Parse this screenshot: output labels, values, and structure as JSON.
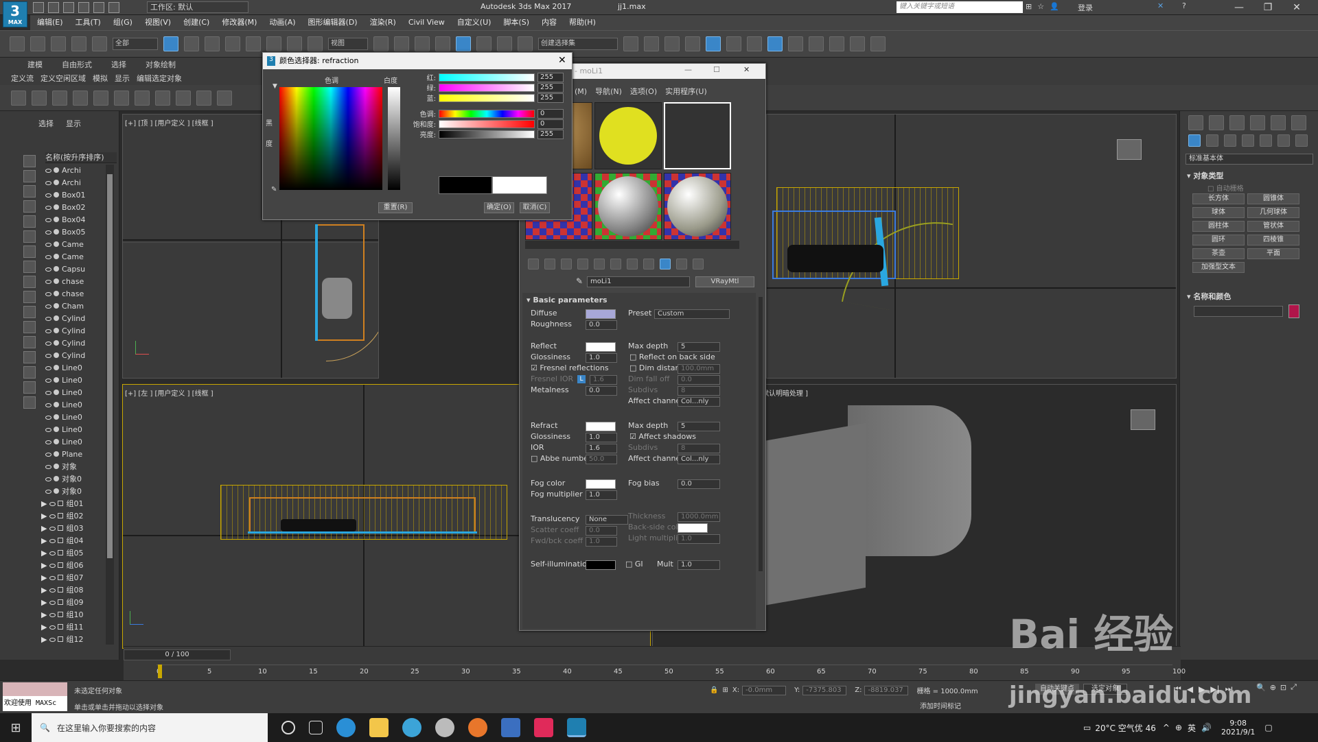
{
  "window": {
    "app_logo": "3",
    "app_logo_sub": "MAX",
    "workspace": "工作区: 默认",
    "title": "Autodesk 3ds Max 2017",
    "file": "jj1.max",
    "search_placeholder": "键入关键字或短语",
    "login": "登录"
  },
  "menu": [
    "编辑(E)",
    "工具(T)",
    "组(G)",
    "视图(V)",
    "创建(C)",
    "修改器(M)",
    "动画(A)",
    "图形编辑器(D)",
    "渲染(R)",
    "Civil View",
    "自定义(U)",
    "脚本(S)",
    "内容",
    "帮助(H)"
  ],
  "toolbar": {
    "filter_dropdown": "全部",
    "view_dropdown": "视图",
    "selection_set_dropdown": "创建选择集"
  },
  "ribbon": {
    "tabs": [
      "建模",
      "自由形式",
      "选择",
      "对象绘制"
    ],
    "sub_items": [
      "定义流",
      "定义空闲区域",
      "模拟",
      "显示",
      "编辑选定对象"
    ]
  },
  "scene_explorer": {
    "tabs": [
      "选择",
      "显示"
    ],
    "header": "名称(按升序排序)",
    "items": [
      "Archi",
      "Archi",
      "Box01",
      "Box02",
      "Box04",
      "Box05",
      "Came",
      "Came",
      "Capsu",
      "chase",
      "chase",
      "Cham",
      "Cylind",
      "Cylind",
      "Cylind",
      "Cylind",
      "Line0",
      "Line0",
      "Line0",
      "Line0",
      "Line0",
      "Line0",
      "Line0",
      "Plane",
      "对象",
      "对象0",
      "对象0"
    ],
    "groups": [
      "组01",
      "组02",
      "组03",
      "组04",
      "组05",
      "组06",
      "组07",
      "组08",
      "组09",
      "组10",
      "组11",
      "组12"
    ]
  },
  "viewports": {
    "top_label": "[+] [顶 ] [用户定义 ] [线框 ]",
    "left_label": "[+] [左 ] [用户定义 ] [线框 ]",
    "persp_label": "默认明暗处理 ]"
  },
  "color_picker": {
    "title": "颜色选择器: refraction",
    "hue_label": "色调",
    "whiteness_label": "白度",
    "black_label": "黑",
    "degree_label": "度",
    "rows": [
      {
        "label": "红:",
        "value": "255"
      },
      {
        "label": "绿:",
        "value": "255"
      },
      {
        "label": "蓝:",
        "value": "255"
      },
      {
        "label": "色调:",
        "value": "0"
      },
      {
        "label": "饱和度:",
        "value": "0"
      },
      {
        "label": "亮度:",
        "value": "255"
      }
    ],
    "reset_button": "重置(R)",
    "ok_button": "确定(O)",
    "cancel_button": "取消(C)"
  },
  "material_editor": {
    "title": "- moLi1",
    "menu": [
      "(M)",
      "导航(N)",
      "选项(O)",
      "实用程序(U)"
    ],
    "material_name": "moLi1",
    "material_type": "VRayMtl",
    "rollout": "Basic parameters",
    "diffuse": {
      "label": "Diffuse",
      "color": "#a8a8d8"
    },
    "preset_label": "Preset",
    "preset_value": "Custom",
    "roughness": {
      "label": "Roughness",
      "value": "0.0"
    },
    "reflect": {
      "label": "Reflect",
      "color": "#ffffff"
    },
    "max_depth_label": "Max depth",
    "max_depth_reflect": "5",
    "glossiness_reflect": {
      "label": "Glossiness",
      "value": "1.0"
    },
    "reflect_back": "Reflect on back side",
    "fresnel": "Fresnel reflections",
    "dim_distance": {
      "label": "Dim distance",
      "value": "100.0mm"
    },
    "fresnel_ior": {
      "label": "Fresnel IOR",
      "value": "1.6",
      "lock": "L"
    },
    "dim_falloff": {
      "label": "Dim fall off",
      "value": "0.0"
    },
    "subdivs_label": "Subdivs",
    "subdivs_value": "8",
    "metalness": {
      "label": "Metalness",
      "value": "0.0"
    },
    "affect_channels_label": "Affect channels",
    "affect_channels_value": "Col...nly",
    "refract": {
      "label": "Refract",
      "color": "#ffffff"
    },
    "max_depth_refract": "5",
    "glossiness_refract": {
      "label": "Glossiness",
      "value": "1.0"
    },
    "affect_shadows": "Affect shadows",
    "ior": {
      "label": "IOR",
      "value": "1.6"
    },
    "abbe": {
      "label": "Abbe number",
      "value": "50.0"
    },
    "fog_color": {
      "label": "Fog color",
      "color": "#ffffff"
    },
    "fog_bias": {
      "label": "Fog bias",
      "value": "0.0"
    },
    "fog_multiplier": {
      "label": "Fog multiplier",
      "value": "1.0"
    },
    "translucency": {
      "label": "Translucency",
      "value": "None"
    },
    "thickness": {
      "label": "Thickness",
      "value": "1000.0mm"
    },
    "scatter": {
      "label": "Scatter coeff",
      "value": "0.0"
    },
    "backside": {
      "label": "Back-side color",
      "color": "#ffffff"
    },
    "fwdbck": {
      "label": "Fwd/bck coeff",
      "value": "1.0"
    },
    "light_mult": {
      "label": "Light multiplier",
      "value": "1.0"
    },
    "self_illum": {
      "label": "Self-illumination",
      "color": "#000000"
    },
    "gi": "GI",
    "mult": {
      "label": "Mult",
      "value": "1.0"
    }
  },
  "command_panel": {
    "dropdown": "标准基本体",
    "section1": "对象类型",
    "auto_grid": "自动栅格",
    "buttons": [
      "长方体",
      "圆锥体",
      "球体",
      "几何球体",
      "圆柱体",
      "管状体",
      "圆环",
      "四棱锥",
      "茶壶",
      "平面",
      "加强型文本"
    ],
    "section2": "名称和颜色",
    "color": "#b0154a"
  },
  "timeline": {
    "slider": "0 / 100",
    "ticks": [
      "0",
      "5",
      "10",
      "15",
      "20",
      "25",
      "30",
      "35",
      "40",
      "45",
      "50",
      "55",
      "60",
      "65",
      "70",
      "75",
      "80",
      "85",
      "90",
      "95",
      "100"
    ]
  },
  "status": {
    "maxscript": "欢迎使用 MAXSc",
    "line1": "未选定任何对象",
    "line2": "单击或单击并拖动以选择对象",
    "x_label": "X:",
    "x_value": "-0.0mm",
    "y_label": "Y:",
    "y_value": "-7375.803",
    "z_label": "Z:",
    "z_value": "-8819.037",
    "grid": "栅格 = 1000.0mm",
    "auto_key": "自动关键点",
    "selected": "选定对象",
    "add_time_tag": "添加时间标记"
  },
  "taskbar": {
    "search": "在这里输入你要搜索的内容",
    "weather": "20°C 空气优 46",
    "ime": "英",
    "time": "9:08",
    "date": "2021/9/1"
  },
  "watermark": {
    "line1": "Bai 经验",
    "line2": "jingyan.baidu.com"
  }
}
